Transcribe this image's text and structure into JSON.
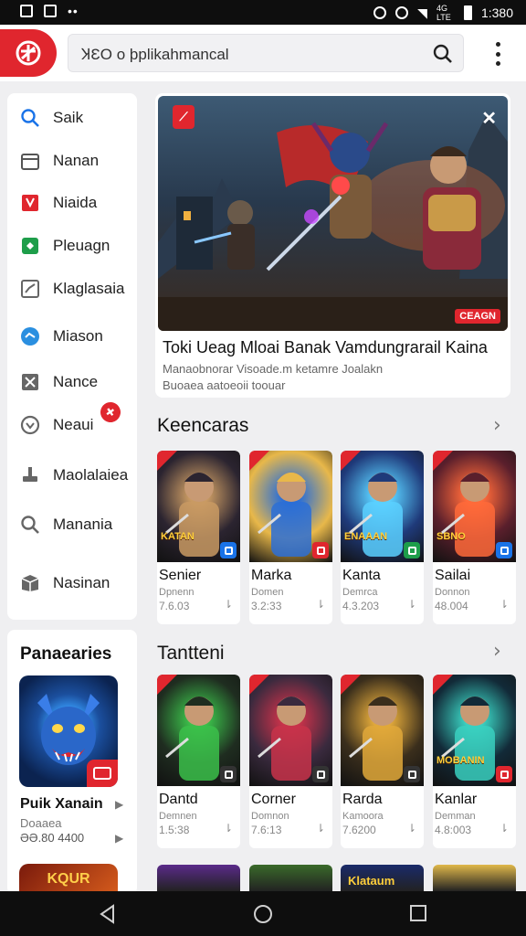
{
  "status_bar": {
    "time": "1:380",
    "icons": [
      "notification-icon",
      "photo-icon",
      "more-icon",
      "sync-icon",
      "target-icon",
      "wifi-icon",
      "signal-icon",
      "battery-icon"
    ],
    "network": "4G LTE"
  },
  "appbar": {
    "search_value": "ꞰƐO o þplikahmancal",
    "search_icon": "search-icon",
    "menu_icon": "more-vert-icon",
    "logo_color": "#e0262e"
  },
  "sidebar": {
    "items": [
      {
        "label": "Saik",
        "icon": "search-icon",
        "color": "#1a73e8"
      },
      {
        "label": "Nanan",
        "icon": "calendar-icon",
        "color": "#555"
      },
      {
        "label": "Niaida",
        "icon": "flag-icon",
        "color": "#e0262e"
      },
      {
        "label": "Pleuagn",
        "icon": "shield-icon",
        "color": "#1e9e4a"
      },
      {
        "label": "Klaglasaia",
        "icon": "chart-icon",
        "color": "#666"
      },
      {
        "label": "Miason",
        "icon": "chat-icon",
        "color": "#2a8fe0"
      },
      {
        "label": "Nance",
        "icon": "close-box-icon",
        "color": "#666"
      },
      {
        "label": "Neaui",
        "icon": "heart-icon",
        "color": "#666"
      },
      {
        "label": "Maolalaiea",
        "icon": "person-icon",
        "color": "#666"
      },
      {
        "label": "Manania",
        "icon": "search-icon",
        "color": "#666"
      },
      {
        "label": "Nasinan",
        "icon": "box-icon",
        "color": "#666"
      }
    ],
    "badge": "✚"
  },
  "panel": {
    "title": "Panaearies",
    "featured_name": "Puik Xanain",
    "featured_dev": "Doaaea",
    "featured_meta": "ƏƏ.80 4400",
    "thumb_text": "KQUR"
  },
  "hero": {
    "title": "Toki Ueag Mloai Banak Vamdungrarail Kaina",
    "subtitle_1": "Manaobnorar Visoade.m ketamre Joalakn",
    "subtitle_2": "Buoaea aatoeoii toouar",
    "badge_tag": "CEAGN",
    "close_icon": "close-icon"
  },
  "section_1": {
    "title": "Keencaras",
    "cards": [
      {
        "name": "Senier",
        "dev": "Dpnenn",
        "meta": "7.6.03",
        "banner": "KATAN",
        "mini_color": "#1a73e8",
        "bg": "#2b2430",
        "accent": "#c99a63"
      },
      {
        "name": "Marka",
        "dev": "Domen",
        "meta": "3.2:33",
        "banner": "",
        "mini_color": "#e0262e",
        "bg": "#e8b84a",
        "accent": "#2b6fd6"
      },
      {
        "name": "Kanta",
        "dev": "Demrca",
        "meta": "4.3.203",
        "banner": "ENAAAN",
        "mini_color": "#1e9e4a",
        "bg": "#1f3a7a",
        "accent": "#5ad0ff"
      },
      {
        "name": "Sailai",
        "dev": "Donnon",
        "meta": "48.004",
        "banner": "SBNO",
        "mini_color": "#1a73e8",
        "bg": "#5a1f2c",
        "accent": "#ff6a3a"
      }
    ]
  },
  "section_2": {
    "title": "Tantteni",
    "cards": [
      {
        "name": "Dantd",
        "dev": "Demnen",
        "meta": "1.5:38",
        "banner": "",
        "mini_color": "#333",
        "bg": "#1f2d20",
        "accent": "#3bbf4a"
      },
      {
        "name": "Corner",
        "dev": "Domnon",
        "meta": "7.6:13",
        "banner": "",
        "mini_color": "#333",
        "bg": "#3a2a3e",
        "accent": "#c8324a"
      },
      {
        "name": "Rarda",
        "dev": "Kamoora",
        "meta": "7.6200",
        "banner": "",
        "mini_color": "#333",
        "bg": "#3a2e1c",
        "accent": "#e0a83a"
      },
      {
        "name": "Kanlar",
        "dev": "Demman",
        "meta": "4.8:003",
        "banner": "MOBANIN",
        "mini_color": "#e0262e",
        "bg": "#122a38",
        "accent": "#3ad0c0"
      }
    ]
  },
  "section_3": {
    "thumbs": [
      "#5a2a8a",
      "#3a6a2a",
      "#1a2a6a",
      "#e0b84a"
    ],
    "thumb_text": "Klataum"
  },
  "navbar": {
    "back_icon": "back-icon",
    "home_icon": "home-icon",
    "recents_icon": "recents-icon"
  }
}
